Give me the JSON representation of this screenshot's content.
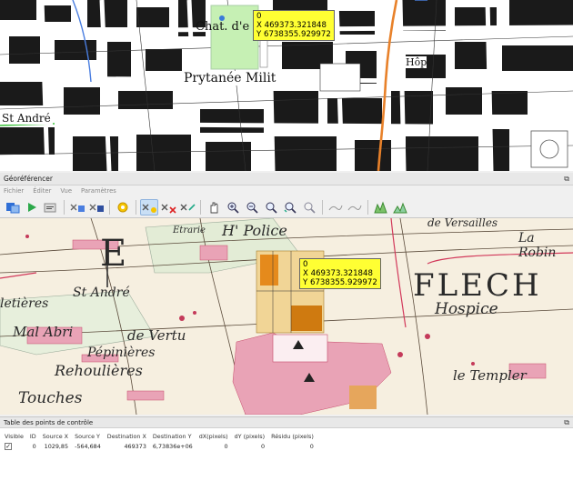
{
  "top_map": {
    "labels": {
      "chateau": "Chat. d'e",
      "prytanee": "Prytanée Milit",
      "st_andre": "St André",
      "hop": "Hôp"
    }
  },
  "callout_top": {
    "id": "0",
    "x": "X 469373.321848",
    "y": "Y 6738355.929972"
  },
  "georeferencer": {
    "title": "Géoréférencer",
    "menu": [
      "Fichier",
      "Éditer",
      "Vue",
      "Paramètres"
    ],
    "toolbar_icons": [
      "open-raster-icon",
      "start-georeferencing-icon",
      "generate-script-icon",
      "load-gcp-icon",
      "save-gcp-icon",
      "transformation-settings-icon",
      "add-point-icon",
      "delete-point-icon",
      "move-point-icon",
      "pan-icon",
      "zoom-in-icon",
      "zoom-out-icon",
      "zoom-to-layer-icon",
      "zoom-last-icon",
      "zoom-next-icon",
      "link-geo-to-qgis-icon",
      "link-qgis-to-geo-icon",
      "full-histogram-stretch-icon",
      "local-histogram-stretch-icon"
    ],
    "map_labels": {
      "letter_e": "E",
      "h_police": "H' Police",
      "etrarie": "Etrarie",
      "versailles": "de Versailles",
      "la_robin": "La Robin",
      "flech": "FLECH",
      "hospice": "Hospice",
      "st_andre": "St André",
      "mal_abri": "Mal Abri",
      "vertu": "de Vertu",
      "pepinieres": "Pépinières",
      "rehoulieres": "Rehoulières",
      "touches": "Touches",
      "le_templer": "le Templer",
      "letieres": "letières"
    },
    "callout": {
      "id": "0",
      "x": "X 469373.321848",
      "y": "Y 6738355.929972"
    }
  },
  "gcp_table": {
    "title": "Table des points de contrôle",
    "columns": [
      "Visible",
      "ID",
      "Source X",
      "Source Y",
      "Destination X",
      "Destination Y",
      "dX(pixels)",
      "dY (pixels)",
      "Résidu (pixels)"
    ],
    "rows": [
      {
        "visible": true,
        "id": "0",
        "source_x": "1029,85",
        "source_y": "-564,684",
        "dest_x": "469373",
        "dest_y": "6,73836e+06",
        "dx": "0",
        "dy": "0",
        "residual": "0"
      }
    ]
  },
  "colors": {
    "callout": "#ffff33",
    "road_orange": "#e8812a",
    "urban_pink": "#e8a0b0"
  }
}
